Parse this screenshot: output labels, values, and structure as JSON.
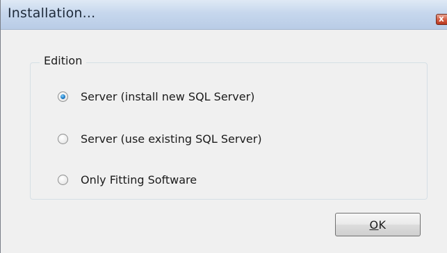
{
  "window": {
    "title": "Installation...",
    "close_symbol": "x",
    "close_icon_name": "close-icon"
  },
  "edition_group": {
    "legend": "Edition",
    "options": [
      {
        "label": "Server (install new SQL Server)",
        "checked": true
      },
      {
        "label": "Server (use existing SQL Server)",
        "checked": false
      },
      {
        "label": "Only Fitting Software",
        "checked": false
      }
    ]
  },
  "ok_button": {
    "accelerator": "O",
    "rest": "K"
  },
  "colors": {
    "titlebar": "#c6d7ed",
    "dialog_bg": "#f0f0f0",
    "radio_selected": "#2a8ad4",
    "close_button": "#d2593f"
  }
}
